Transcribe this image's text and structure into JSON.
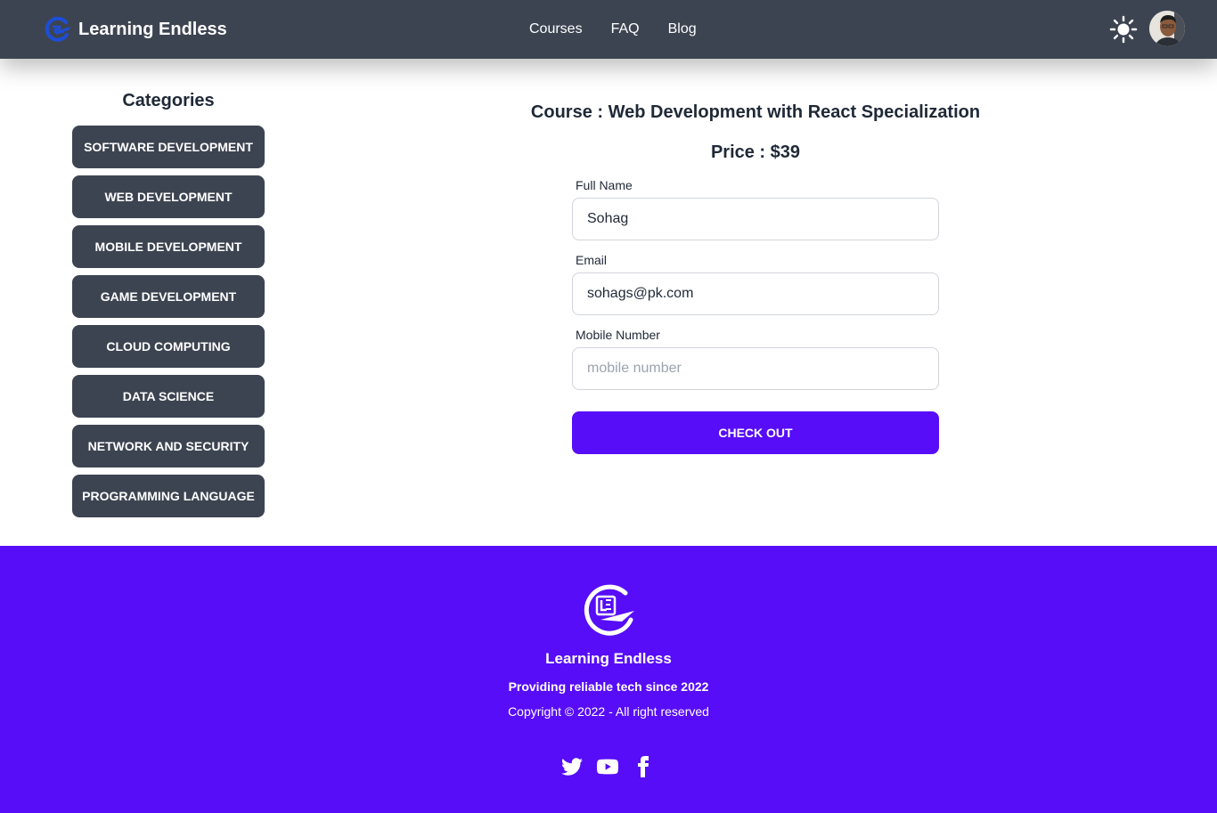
{
  "navbar": {
    "brand": "Learning Endless",
    "links": [
      "Courses",
      "FAQ",
      "Blog"
    ],
    "theme_icon": "sun-icon",
    "avatar_icon": "user-avatar"
  },
  "sidebar": {
    "title": "Categories",
    "categories": [
      "SOFTWARE DEVELOPMENT",
      "WEB DEVELOPMENT",
      "MOBILE DEVELOPMENT",
      "GAME DEVELOPMENT",
      "CLOUD COMPUTING",
      "DATA SCIENCE",
      "NETWORK AND SECURITY",
      "PROGRAMMING LANGUAGE"
    ]
  },
  "checkout": {
    "course_title": "Course : Web Development with React Specialization",
    "price": "Price : $39",
    "fields": {
      "full_name": {
        "label": "Full Name",
        "value": "Sohag"
      },
      "email": {
        "label": "Email",
        "value": "sohags@pk.com"
      },
      "mobile": {
        "label": "Mobile Number",
        "placeholder": "mobile number"
      }
    },
    "button": "CHECK OUT"
  },
  "footer": {
    "name": "Learning Endless",
    "tagline": "Providing reliable tech since 2022",
    "copyright": "Copyright © 2022 - All right reserved",
    "social_icons": [
      "twitter-icon",
      "youtube-icon",
      "facebook-icon"
    ]
  },
  "colors": {
    "navbar": "#3d4451",
    "primary": "#570df8",
    "brand_icon": "#1d4ed8"
  }
}
